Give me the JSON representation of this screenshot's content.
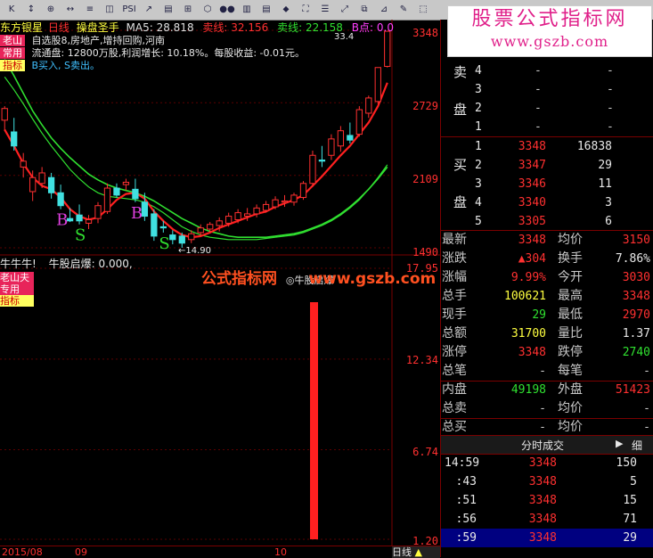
{
  "toolbar": {
    "items": [
      "K",
      "↕",
      "⊕",
      "↔",
      "≡",
      "◫",
      "PSI",
      "↗",
      "▤",
      "⊞",
      "⬡",
      "●●",
      "▥",
      "▤",
      "⬥",
      "⛶",
      "☰",
      "⤢",
      "⧉",
      "⊿",
      "✎",
      "⬚"
    ],
    "watermark_line1": "股票公式指标网",
    "watermark_line2": "www.gszb.com"
  },
  "chart": {
    "stock_name": "东方银星",
    "period": "日线",
    "indicator_name": "操盘圣手",
    "ma5_label": "MA5: 28.818",
    "sell_line_label": "卖线: 32.156",
    "sell_line2_label": "卖线: 22.158",
    "b_label": "B点: 0.0",
    "tag_laoshan": "老山",
    "tag_changyong": "常用",
    "tag_zhibiao": "指标",
    "info_line1": "自选股8,房地产,增持回购,河南",
    "info_line2": "流通盘: 12800万股,利润增长: 10.18%。每股收益: -0.01元。",
    "info_line3": "B买入, S卖出。",
    "marker_high": "33.4",
    "marker_low": "14.90",
    "price_labels": [
      "3348",
      "2729",
      "2109",
      "1490"
    ],
    "buy_signal": "B",
    "sell_signal": "S",
    "sub_title": "牛牛牛!",
    "sub_indicator": "牛股启爆: 0.000,",
    "sub_legend": "牛股启爆",
    "sub_tags": [
      "老山夫",
      "专用",
      "指标"
    ],
    "sub_values": [
      "17.95",
      "12.34",
      "6.74",
      "1.20"
    ],
    "overlay_text": "公式指标网",
    "overlay_url": "www.gszb.com",
    "date_labels": [
      "2015/08",
      "09",
      "10"
    ],
    "period_tab": "日线"
  },
  "orderbook": {
    "sell_label": [
      "卖",
      "盘"
    ],
    "buy_label": [
      "买",
      "盘"
    ],
    "sell_rows": [
      {
        "n": "4",
        "price": "-",
        "vol": "-"
      },
      {
        "n": "3",
        "price": "-",
        "vol": "-"
      },
      {
        "n": "2",
        "price": "-",
        "vol": "-"
      },
      {
        "n": "1",
        "price": "-",
        "vol": "-"
      }
    ],
    "buy_rows": [
      {
        "n": "1",
        "price": "3348",
        "vol": "16838"
      },
      {
        "n": "2",
        "price": "3347",
        "vol": "29"
      },
      {
        "n": "3",
        "price": "3346",
        "vol": "11"
      },
      {
        "n": "4",
        "price": "3340",
        "vol": "3"
      },
      {
        "n": "5",
        "price": "3305",
        "vol": "6"
      }
    ]
  },
  "stats": [
    {
      "l1": "最新",
      "v1": "3348",
      "c1": "red",
      "l2": "均价",
      "v2": "3150",
      "c2": "red"
    },
    {
      "l1": "涨跌",
      "v1": "▲304",
      "c1": "red",
      "l2": "换手",
      "v2": "7.86%",
      "c2": "white"
    },
    {
      "l1": "涨幅",
      "v1": "9.99%",
      "c1": "red",
      "l2": "今开",
      "v2": "3030",
      "c2": "red"
    },
    {
      "l1": "总手",
      "v1": "100621",
      "c1": "yellow",
      "l2": "最高",
      "v2": "3348",
      "c2": "red"
    },
    {
      "l1": "现手",
      "v1": "29",
      "c1": "green",
      "l2": "最低",
      "v2": "2970",
      "c2": "red"
    },
    {
      "l1": "总额",
      "v1": "31700",
      "c1": "yellow",
      "l2": "量比",
      "v2": "1.37",
      "c2": "white"
    },
    {
      "l1": "涨停",
      "v1": "3348",
      "c1": "red",
      "l2": "跌停",
      "v2": "2740",
      "c2": "green"
    },
    {
      "l1": "总笔",
      "v1": "-",
      "c1": "grey",
      "l2": "每笔",
      "v2": "-",
      "c2": "grey"
    },
    {
      "l1": "内盘",
      "v1": "49198",
      "c1": "green",
      "l2": "外盘",
      "v2": "51423",
      "c2": "red"
    },
    {
      "l1": "总卖",
      "v1": "-",
      "c1": "grey",
      "l2": "均价",
      "v2": "-",
      "c2": "grey"
    },
    {
      "l1": "总买",
      "v1": "-",
      "c1": "grey",
      "l2": "均价",
      "v2": "-",
      "c2": "grey"
    }
  ],
  "ticks": {
    "tab_label": "分时成交",
    "detail_label": "细",
    "rows": [
      {
        "time": "14:59",
        "price": "3348",
        "vol": "150"
      },
      {
        "time": ":43",
        "price": "3348",
        "vol": "5"
      },
      {
        "time": ":51",
        "price": "3348",
        "vol": "15"
      },
      {
        "time": ":56",
        "price": "3348",
        "vol": "71"
      },
      {
        "time": ":59",
        "price": "3348",
        "vol": "29"
      }
    ]
  },
  "chart_data": {
    "type": "candlestick",
    "note": "K-line with MA curves; prices from right axis labels",
    "ylim": [
      14.9,
      33.48
    ],
    "y_ticks": [
      33.48,
      27.29,
      21.09,
      14.9
    ],
    "candles": [
      {
        "o": 25.8,
        "h": 27.0,
        "l": 24.9,
        "c": 26.8
      },
      {
        "o": 24.8,
        "h": 26.0,
        "l": 23.2,
        "c": 23.6
      },
      {
        "o": 21.8,
        "h": 23.0,
        "l": 20.9,
        "c": 22.3
      },
      {
        "o": 19.7,
        "h": 21.5,
        "l": 18.9,
        "c": 20.9
      },
      {
        "o": 20.4,
        "h": 21.8,
        "l": 20.0,
        "c": 21.3
      },
      {
        "o": 20.9,
        "h": 21.3,
        "l": 19.1,
        "c": 19.6
      },
      {
        "o": 19.6,
        "h": 20.3,
        "l": 18.2,
        "c": 18.5
      },
      {
        "o": 17.4,
        "h": 18.3,
        "l": 17.1,
        "c": 17.2
      },
      {
        "o": 17.7,
        "h": 18.6,
        "l": 16.9,
        "c": 17.2
      },
      {
        "o": 17.0,
        "h": 17.7,
        "l": 16.5,
        "c": 17.3
      },
      {
        "o": 17.4,
        "h": 18.8,
        "l": 17.0,
        "c": 18.5
      },
      {
        "o": 18.0,
        "h": 20.4,
        "l": 17.8,
        "c": 20.0
      },
      {
        "o": 20.0,
        "h": 20.4,
        "l": 19.2,
        "c": 19.4
      },
      {
        "o": 20.3,
        "h": 20.8,
        "l": 19.8,
        "c": 20.5
      },
      {
        "o": 19.9,
        "h": 20.8,
        "l": 18.8,
        "c": 19.1
      },
      {
        "o": 18.8,
        "h": 19.6,
        "l": 17.2,
        "c": 17.6
      },
      {
        "o": 17.8,
        "h": 18.2,
        "l": 15.5,
        "c": 15.9
      },
      {
        "o": 16.7,
        "h": 17.2,
        "l": 16.2,
        "c": 16.6
      },
      {
        "o": 16.0,
        "h": 16.4,
        "l": 15.2,
        "c": 15.6
      },
      {
        "o": 15.9,
        "h": 16.2,
        "l": 14.9,
        "c": 15.3
      },
      {
        "o": 15.6,
        "h": 16.4,
        "l": 15.3,
        "c": 16.1
      },
      {
        "o": 16.2,
        "h": 16.9,
        "l": 15.9,
        "c": 16.6
      },
      {
        "o": 16.5,
        "h": 17.1,
        "l": 16.2,
        "c": 16.9
      },
      {
        "o": 16.8,
        "h": 17.5,
        "l": 16.3,
        "c": 17.2
      },
      {
        "o": 17.0,
        "h": 17.9,
        "l": 16.7,
        "c": 17.6
      },
      {
        "o": 17.3,
        "h": 18.2,
        "l": 17.0,
        "c": 17.9
      },
      {
        "o": 17.6,
        "h": 18.3,
        "l": 17.2,
        "c": 17.8
      },
      {
        "o": 17.8,
        "h": 18.6,
        "l": 17.5,
        "c": 18.3
      },
      {
        "o": 18.1,
        "h": 18.9,
        "l": 17.9,
        "c": 18.6
      },
      {
        "o": 18.4,
        "h": 19.3,
        "l": 18.2,
        "c": 19.0
      },
      {
        "o": 18.8,
        "h": 19.4,
        "l": 18.4,
        "c": 18.9
      },
      {
        "o": 18.8,
        "h": 19.6,
        "l": 18.5,
        "c": 19.4
      },
      {
        "o": 19.2,
        "h": 20.6,
        "l": 19.0,
        "c": 20.4
      },
      {
        "o": 20.4,
        "h": 23.2,
        "l": 20.1,
        "c": 22.8
      },
      {
        "o": 22.4,
        "h": 23.6,
        "l": 21.8,
        "c": 22.3
      },
      {
        "o": 22.8,
        "h": 24.6,
        "l": 22.4,
        "c": 24.2
      },
      {
        "o": 23.6,
        "h": 25.3,
        "l": 23.1,
        "c": 24.9
      },
      {
        "o": 24.5,
        "h": 25.6,
        "l": 23.8,
        "c": 24.1
      },
      {
        "o": 24.6,
        "h": 27.0,
        "l": 24.4,
        "c": 26.7
      },
      {
        "o": 26.4,
        "h": 27.9,
        "l": 26.0,
        "c": 27.7
      },
      {
        "o": 27.4,
        "h": 30.3,
        "l": 27.2,
        "c": 30.3
      },
      {
        "o": 30.4,
        "h": 33.4,
        "l": 30.3,
        "c": 33.4
      }
    ],
    "ma_red": [
      25.0,
      23.6,
      22.1,
      20.9,
      20.2,
      19.9,
      19.2,
      18.2,
      17.6,
      17.3,
      17.5,
      18.2,
      19.0,
      19.5,
      19.6,
      19.1,
      18.0,
      17.2,
      16.5,
      16.0,
      15.8,
      15.9,
      16.2,
      16.6,
      16.9,
      17.2,
      17.5,
      17.8,
      18.0,
      18.4,
      18.7,
      19.0,
      19.4,
      20.2,
      21.0,
      21.9,
      22.8,
      23.6,
      24.6,
      25.6,
      27.0,
      29.0
    ],
    "ma_green": [
      29.5,
      28.4,
      27.2,
      25.9,
      24.7,
      23.6,
      22.6,
      21.6,
      20.8,
      20.1,
      19.6,
      19.3,
      19.2,
      19.1,
      19.0,
      18.8,
      18.4,
      17.9,
      17.3,
      16.7,
      16.3,
      16.0,
      15.8,
      15.7,
      15.6,
      15.6,
      15.6,
      15.6,
      15.7,
      15.8,
      15.9,
      16.0,
      16.2,
      16.5,
      16.8,
      17.2,
      17.7,
      18.3,
      19.0,
      19.9,
      20.9,
      22.0
    ],
    "ma_green2": [
      31.0,
      29.6,
      28.1,
      26.6,
      25.4,
      24.3,
      23.4,
      22.6,
      21.9,
      21.2,
      20.7,
      20.3,
      20.0,
      19.8,
      19.6,
      19.3,
      18.9,
      18.4,
      17.9,
      17.4,
      17.0,
      16.6,
      16.3,
      16.1,
      15.9,
      15.8,
      15.8,
      15.8,
      15.8,
      15.9,
      16.0,
      16.1,
      16.3,
      16.6,
      16.9,
      17.3,
      17.8,
      18.4,
      19.1,
      19.9,
      20.8,
      21.8
    ],
    "signals": [
      {
        "idx": 6,
        "label": "B"
      },
      {
        "idx": 8,
        "label": "S"
      },
      {
        "idx": 14,
        "label": "B"
      },
      {
        "idx": 17,
        "label": "S"
      }
    ],
    "sub_ylim": [
      1.2,
      17.95
    ],
    "sub_bar": {
      "idx": 36,
      "value": 17.95
    }
  }
}
